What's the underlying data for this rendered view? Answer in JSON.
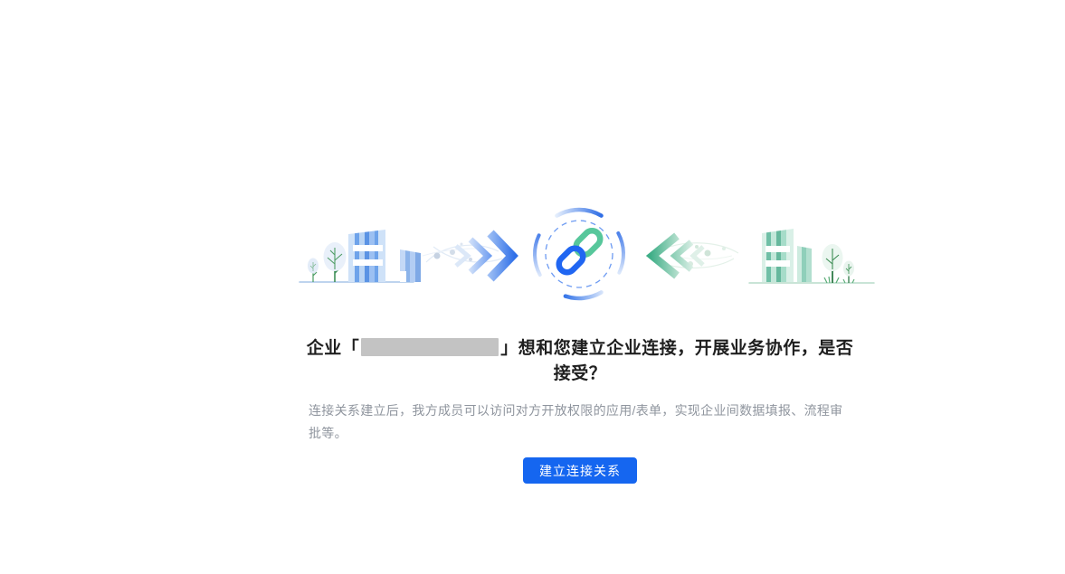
{
  "invite": {
    "heading_prefix": "企业「",
    "heading_suffix": "」想和您建立企业连接，开展业务协作，是否接受？",
    "company_name_hidden": "",
    "description": "连接关系建立后，我方成员可以访问对方开放权限的应用/表单，实现企业间数据填报、流程审批等。",
    "accept_button_label": "建立连接关系"
  },
  "illustration": {
    "left_company_icon": "blue-buildings-with-trees",
    "forward_arrow_icon": "double-chevron-right-with-particles",
    "center_icon": "chain-link-in-dashed-circle",
    "backward_arrow_icon": "double-chevron-left-with-particles",
    "right_company_icon": "green-buildings-with-trees",
    "colors": {
      "accent_blue": "#1566f0",
      "link_blue": "#2066f2",
      "link_green": "#57c79b",
      "building_blue": "#5b93e4",
      "building_green": "#6fbfa6",
      "dashed_circle_blue": "#6d9bf2",
      "heading_text": "#1f1f1f",
      "description_text": "#8f959e",
      "redaction_gray": "#c3c3c3"
    }
  }
}
